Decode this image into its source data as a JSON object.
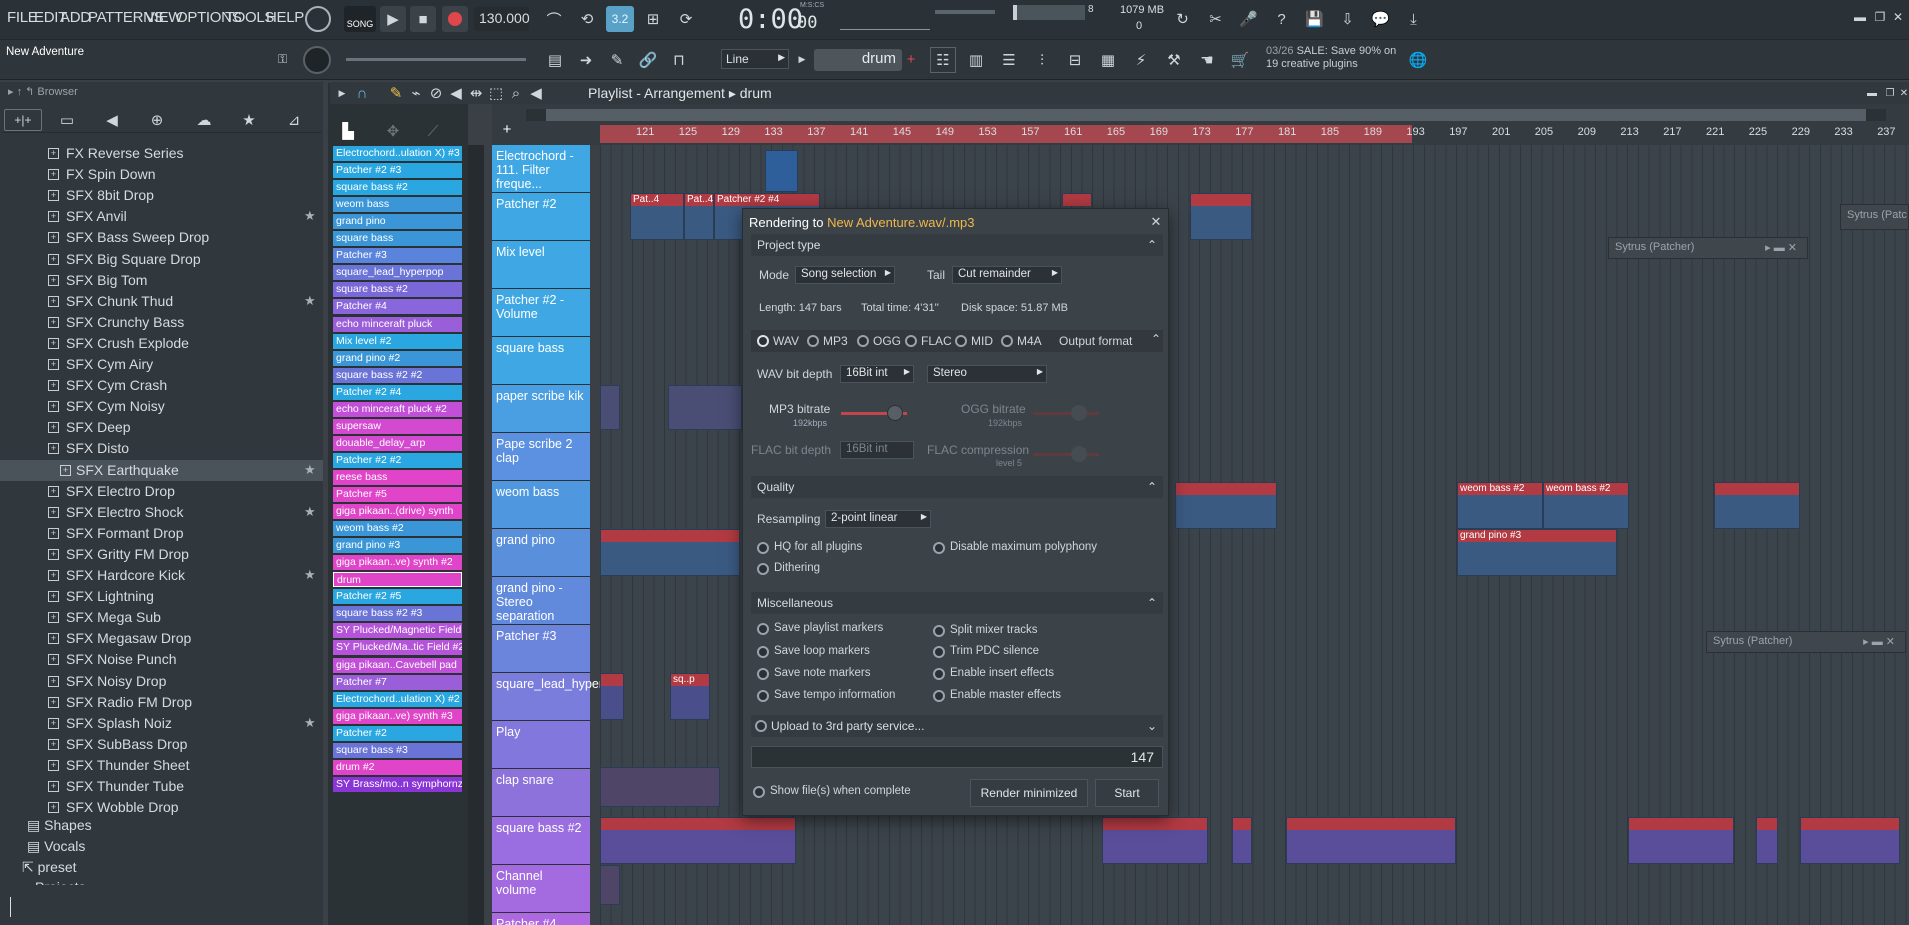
{
  "menu": {
    "file": "FILE",
    "edit": "EDIT",
    "add": "ADD",
    "patterns": "PATTERNS",
    "view": "VIEW",
    "options": "OPTIONS",
    "tools": "TOOLS",
    "help": "HELP"
  },
  "transport": {
    "mode": "SONG",
    "tempo": "130.000",
    "time": "0:00",
    "time_sub": "00",
    "time_label": "M:S:CS",
    "memory": "1079 MB",
    "cpu_num": "8",
    "poly": "0"
  },
  "project": {
    "name": "New Adventure"
  },
  "toolbar2": {
    "snap": "Line",
    "pattern": "drum",
    "news_date": "03/26",
    "news_text": "SALE: Save 90% on 19 creative plugins"
  },
  "browser": {
    "title": "Browser",
    "items": [
      {
        "label": "FX Reverse Series",
        "star": false
      },
      {
        "label": "FX Spin Down",
        "star": false
      },
      {
        "label": "SFX 8bit Drop",
        "star": false
      },
      {
        "label": "SFX Anvil",
        "star": true
      },
      {
        "label": "SFX Bass Sweep Drop",
        "star": false
      },
      {
        "label": "SFX Big Square Drop",
        "star": false
      },
      {
        "label": "SFX Big Tom",
        "star": false
      },
      {
        "label": "SFX Chunk Thud",
        "star": true
      },
      {
        "label": "SFX Crunchy Bass",
        "star": false
      },
      {
        "label": "SFX Crush Explode",
        "star": false
      },
      {
        "label": "SFX Cym Airy",
        "star": false
      },
      {
        "label": "SFX Cym Crash",
        "star": false
      },
      {
        "label": "SFX Cym Noisy",
        "star": false
      },
      {
        "label": "SFX Deep",
        "star": false
      },
      {
        "label": "SFX Disto",
        "star": false
      },
      {
        "label": "SFX Earthquake",
        "star": true
      },
      {
        "label": "SFX Electro Drop",
        "star": false
      },
      {
        "label": "SFX Electro Shock",
        "star": true
      },
      {
        "label": "SFX Formant Drop",
        "star": false
      },
      {
        "label": "SFX Gritty FM Drop",
        "star": false
      },
      {
        "label": "SFX Hardcore Kick",
        "star": true
      },
      {
        "label": "SFX Lightning",
        "star": false
      },
      {
        "label": "SFX Mega Sub",
        "star": false
      },
      {
        "label": "SFX Megasaw Drop",
        "star": false
      },
      {
        "label": "SFX Noise Punch",
        "star": false
      },
      {
        "label": "SFX Noisy Drop",
        "star": false
      },
      {
        "label": "SFX Radio FM Drop",
        "star": false
      },
      {
        "label": "SFX Splash Noiz",
        "star": true
      },
      {
        "label": "SFX SubBass Drop",
        "star": false
      },
      {
        "label": "SFX Thunder Sheet",
        "star": false
      },
      {
        "label": "SFX Thunder Tube",
        "star": false
      },
      {
        "label": "SFX Wobble Drop",
        "star": false
      }
    ],
    "folders": [
      "Shapes",
      "Vocals"
    ],
    "preset": "preset",
    "cut": "Projects"
  },
  "picker": [
    {
      "label": "Electrochord..ulation X) #3",
      "c": "#2aa7e0"
    },
    {
      "label": "Patcher #2 #3",
      "c": "#2aa7e0"
    },
    {
      "label": "square bass #2",
      "c": "#2aa7e0"
    },
    {
      "label": "weom bass",
      "c": "#3b96d8"
    },
    {
      "label": "grand pino",
      "c": "#3b96d8"
    },
    {
      "label": "square bass",
      "c": "#3b96d8"
    },
    {
      "label": "Patcher #3",
      "c": "#5a84dc"
    },
    {
      "label": "square_lead_hyperpop",
      "c": "#6a74d6"
    },
    {
      "label": "square bass #2",
      "c": "#7a68d8"
    },
    {
      "label": "Patcher #4",
      "c": "#8a66dc"
    },
    {
      "label": "echo minceraft pluck",
      "c": "#9a5fd8"
    },
    {
      "label": "Mix level #2",
      "c": "#2aa7e0"
    },
    {
      "label": "grand pino #2",
      "c": "#3b96d8"
    },
    {
      "label": "square bass #2 #2",
      "c": "#6a74d6"
    },
    {
      "label": "Patcher #2 #4",
      "c": "#2aa7e0"
    },
    {
      "label": "echo minceraft pluck #2",
      "c": "#c24fd8"
    },
    {
      "label": "supersaw",
      "c": "#d34ad0"
    },
    {
      "label": "douable_delay_arp",
      "c": "#d34ad0"
    },
    {
      "label": "Patcher #2 #2",
      "c": "#2aa7e0"
    },
    {
      "label": "reese bass",
      "c": "#e044c8"
    },
    {
      "label": "Patcher #5",
      "c": "#e044c8"
    },
    {
      "label": "giga pikaan..(drive) synth",
      "c": "#e044c8"
    },
    {
      "label": "weom bass #2",
      "c": "#3b96d8"
    },
    {
      "label": "grand pino #3",
      "c": "#3b96d8"
    },
    {
      "label": "giga pikaan..ve) synth #2",
      "c": "#e044c8"
    },
    {
      "label": "drum",
      "c": "#e044c8"
    },
    {
      "label": "Patcher #2 #5",
      "c": "#2aa7e0"
    },
    {
      "label": "square bass #2 #3",
      "c": "#6a74d6"
    },
    {
      "label": "SY Plucked/Magnetic Field",
      "c": "#b554d8"
    },
    {
      "label": "SY Plucked/Ma..tic Field #2",
      "c": "#b554d8"
    },
    {
      "label": "giga pikaan..Cavebell pad",
      "c": "#c24fd8"
    },
    {
      "label": "Patcher #7",
      "c": "#9a5fd8"
    },
    {
      "label": "Electrochord..ulation X) #2",
      "c": "#2aa7e0"
    },
    {
      "label": "giga pikaan..ve) synth #3",
      "c": "#e044c8"
    },
    {
      "label": "Patcher #2",
      "c": "#2aa7e0"
    },
    {
      "label": "square bass #3",
      "c": "#6a74d6"
    },
    {
      "label": "drum #2",
      "c": "#e044c8"
    },
    {
      "label": "SY Brass/mo..n symphornz",
      "c": "#8a36d6"
    }
  ],
  "playlist": {
    "title": "Playlist - Arrangement",
    "pattern": "drum",
    "ruler": [
      "121",
      "125",
      "129",
      "133",
      "137",
      "141",
      "145",
      "149",
      "153",
      "157",
      "161",
      "165",
      "169",
      "173",
      "177",
      "181",
      "185",
      "189",
      "193",
      "197",
      "201",
      "205",
      "209",
      "213",
      "217",
      "221",
      "225",
      "229",
      "233",
      "237"
    ],
    "tracks": [
      "Electrochord - 111. Filter freque...",
      "Patcher #2",
      "Mix level",
      "Patcher #2 - Volume",
      "square bass",
      "paper scribe kik",
      "Pape scribe 2 clap",
      "weom bass",
      "grand pino",
      "grand pino - Stereo separation",
      "Patcher #3",
      "square_lead_hyperpop",
      "Play",
      "clap snare",
      "square bass #2",
      "Channel volume",
      "Patcher #4"
    ],
    "clips": [
      "Pat..4",
      "Pat..4",
      "Patcher #2 #4",
      "weom bass #2",
      "weom bass #2",
      "grand pino #3",
      "sq..p",
      "sq..2",
      "sq..2"
    ]
  },
  "plugins": {
    "sytrus1": "Sytrus (Patcher)",
    "sytrus2": "Sytrus (Patcher)",
    "sytrus3": "Sytrus (Patc"
  },
  "dialog": {
    "title_prefix": "Rendering to",
    "title_file": "New Adventure.wav/.mp3",
    "project_type": "Project type",
    "mode_label": "Mode",
    "mode": "Song selection",
    "tail_label": "Tail",
    "tail": "Cut remainder",
    "length": "Length: 147 bars",
    "total_time": "Total time: 4'31''",
    "disk": "Disk space: 51.87 MB",
    "formats": [
      "WAV",
      "MP3",
      "OGG",
      "FLAC",
      "MID",
      "M4A"
    ],
    "output_format": "Output format",
    "wav_bit_label": "WAV bit depth",
    "wav_bit": "16Bit int",
    "stereo": "Stereo",
    "mp3_label": "MP3 bitrate",
    "mp3_sub": "192kbps",
    "ogg_label": "OGG bitrate",
    "ogg_sub": "192kbps",
    "flac_bit_label": "FLAC bit depth",
    "flac_bit": "16Bit int",
    "flac_comp_label": "FLAC compression",
    "flac_comp_sub": "level 5",
    "quality": "Quality",
    "resampling_label": "Resampling",
    "resampling": "2-point linear",
    "hq": "HQ for all plugins",
    "disable_poly": "Disable maximum polyphony",
    "dithering": "Dithering",
    "misc": "Miscellaneous",
    "save_markers": "Save playlist markers",
    "split_mixer": "Split mixer tracks",
    "save_loop": "Save loop markers",
    "trim_pdc": "Trim PDC silence",
    "save_note": "Save note markers",
    "enable_insert": "Enable insert effects",
    "save_tempo": "Save tempo information",
    "enable_master": "Enable master effects",
    "upload": "Upload to 3rd party service...",
    "progress_value": "147",
    "show_files": "Show file(s) when complete",
    "render_minimized": "Render minimized",
    "start": "Start"
  }
}
